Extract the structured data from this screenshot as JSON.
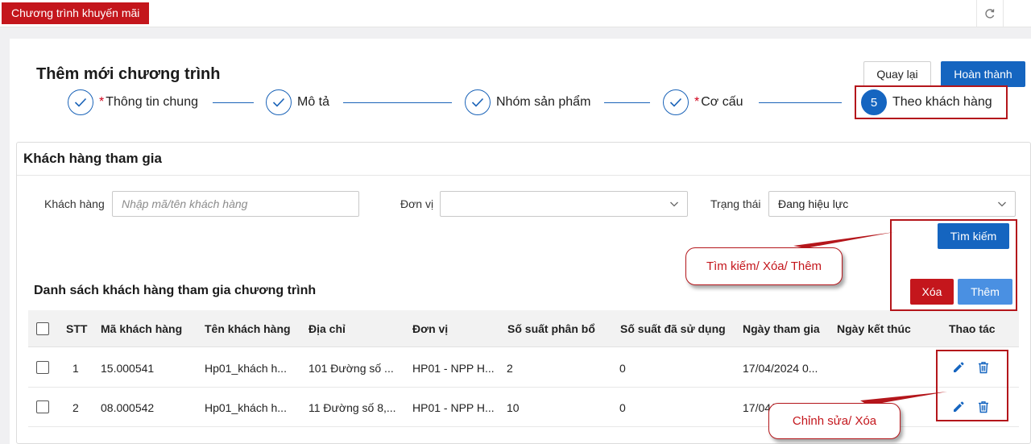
{
  "app_tab": "Chương trình khuyến mãi",
  "page_title": "Thêm mới chương trình",
  "buttons": {
    "back": "Quay lại",
    "done": "Hoàn thành",
    "search": "Tìm kiếm",
    "delete": "Xóa",
    "add": "Thêm"
  },
  "steps": [
    {
      "label": "Thông tin chung",
      "required": "*",
      "status": "done"
    },
    {
      "label": "Mô tả",
      "required": "",
      "status": "done"
    },
    {
      "label": "Nhóm sản phẩm",
      "required": "",
      "status": "done"
    },
    {
      "label": "Cơ cấu",
      "required": "*",
      "status": "done"
    },
    {
      "label": "Theo khách hàng",
      "number": "5",
      "status": "active"
    }
  ],
  "card_title": "Khách hàng tham gia",
  "filters": {
    "customer_label": "Khách hàng",
    "customer_placeholder": "Nhập mã/tên khách hàng",
    "unit_label": "Đơn vị",
    "unit_value": "",
    "status_label": "Trạng thái",
    "status_value": "Đang hiệu lực"
  },
  "section_title": "Danh sách khách hàng tham gia chương trình",
  "table": {
    "headers": [
      "STT",
      "Mã khách hàng",
      "Tên khách hàng",
      "Địa chỉ",
      "Đơn vị",
      "Số suất phân bổ",
      "Số suất đã sử dụng",
      "Ngày tham gia",
      "Ngày kết thúc",
      "Thao tác"
    ],
    "rows": [
      {
        "stt": "1",
        "code": "15.000541",
        "name": "Hp01_khách h...",
        "address": "101 Đường số ...",
        "unit": "HP01 - NPP H...",
        "allocated": "2",
        "used": "0",
        "join_date": "17/04/2024 0...",
        "end_date": ""
      },
      {
        "stt": "2",
        "code": "08.000542",
        "name": "Hp01_khách h...",
        "address": "11 Đường số 8,...",
        "unit": "HP01 - NPP H...",
        "allocated": "10",
        "used": "0",
        "join_date": "17/04/2024 0...",
        "end_date": ""
      }
    ]
  },
  "annotations": {
    "callout1": "Tìm kiếm/ Xóa/ Thêm",
    "callout2": "Chỉnh sửa/ Xóa"
  },
  "colors": {
    "primary": "#1565c0",
    "danger": "#c4161c",
    "annotation": "#b4161b",
    "add": "#4a90e2"
  }
}
